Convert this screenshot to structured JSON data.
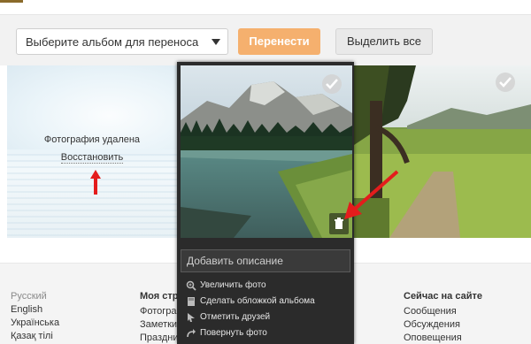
{
  "toolbar": {
    "album_select_value": "Выберите альбом для переноса",
    "move_button": "Перенести",
    "select_all_button": "Выделить все"
  },
  "photos": {
    "deleted_text": "Фотография удалена",
    "restore_link": "Восстановить"
  },
  "panel": {
    "description_placeholder": "Добавить описание",
    "menu": [
      {
        "label": "Увеличить фото",
        "icon": "zoom-icon"
      },
      {
        "label": "Сделать обложкой альбома",
        "icon": "album-cover-icon"
      },
      {
        "label": "Отметить друзей",
        "icon": "cursor-icon"
      },
      {
        "label": "Повернуть фото",
        "icon": "rotate-icon"
      }
    ]
  },
  "footer": {
    "languages": [
      "Русский",
      "English",
      "Українська",
      "Қазақ тілі"
    ],
    "my_page": {
      "heading": "Моя стра",
      "items": [
        "Фотограф",
        "Заметки",
        "Праздни"
      ]
    },
    "now_on_site": {
      "heading": "Сейчас на сайте",
      "items": [
        "Сообщения",
        "Обсуждения",
        "Оповещения"
      ]
    }
  },
  "colors": {
    "accent_button": "#f5b06e",
    "panel_bg": "#2b2b2b",
    "arrow_red": "#e41c1c"
  }
}
